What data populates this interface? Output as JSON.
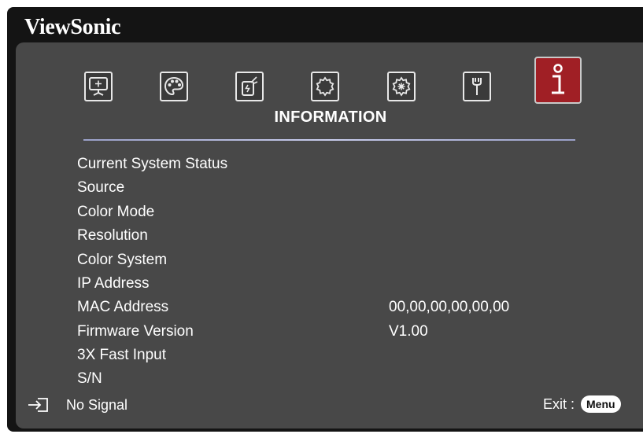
{
  "brand": "ViewSonic",
  "colors": {
    "active_tab": "#a01f25",
    "panel": "#484848",
    "frame": "#141414"
  },
  "tabs": [
    {
      "icon": "display-icon",
      "active": false
    },
    {
      "icon": "color-palette-icon",
      "active": false
    },
    {
      "icon": "power-management-icon",
      "active": false
    },
    {
      "icon": "basic-settings-icon",
      "active": false
    },
    {
      "icon": "advanced-settings-icon",
      "active": false
    },
    {
      "icon": "service-wrench-icon",
      "active": false
    },
    {
      "icon": "information-icon",
      "active": true
    }
  ],
  "section_title": "INFORMATION",
  "rows": [
    {
      "label": "Current System Status",
      "value": ""
    },
    {
      "label": "Source",
      "value": ""
    },
    {
      "label": "Color Mode",
      "value": ""
    },
    {
      "label": "Resolution",
      "value": ""
    },
    {
      "label": "Color System",
      "value": ""
    },
    {
      "label": "IP Address",
      "value": ""
    },
    {
      "label": "MAC Address",
      "value": "00,00,00,00,00,00"
    },
    {
      "label": "Firmware Version",
      "value": "V1.00"
    },
    {
      "label": "3X Fast Input",
      "value": ""
    },
    {
      "label": "S/N",
      "value": ""
    }
  ],
  "footer": {
    "signal_icon": "input-source-icon",
    "signal_text": "No Signal",
    "exit_label": "Exit :",
    "menu_label": "Menu"
  }
}
